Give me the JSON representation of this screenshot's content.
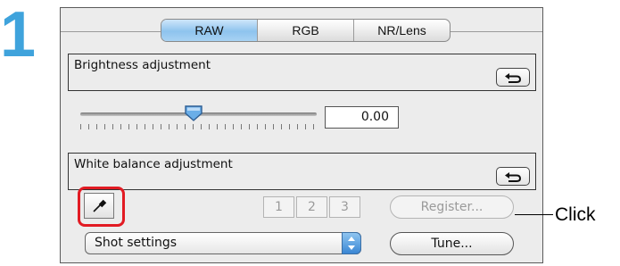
{
  "step": {
    "number": "1",
    "accent": "#3fa3dc"
  },
  "tabs": [
    {
      "label": "RAW",
      "active": true
    },
    {
      "label": "RGB",
      "active": false
    },
    {
      "label": "NR/Lens",
      "active": false
    }
  ],
  "brightness": {
    "label": "Brightness adjustment",
    "value": "0.00",
    "reset_icon": "undo-arrow-icon"
  },
  "white_balance": {
    "label": "White balance adjustment",
    "reset_icon": "undo-arrow-icon",
    "eyedropper_icon": "eyedropper-icon",
    "presets": [
      "1",
      "2",
      "3"
    ],
    "register_label": "Register...",
    "dropdown_value": "Shot settings",
    "tune_label": "Tune..."
  },
  "callout": {
    "label": "Click",
    "highlight_color": "#e21b23"
  }
}
